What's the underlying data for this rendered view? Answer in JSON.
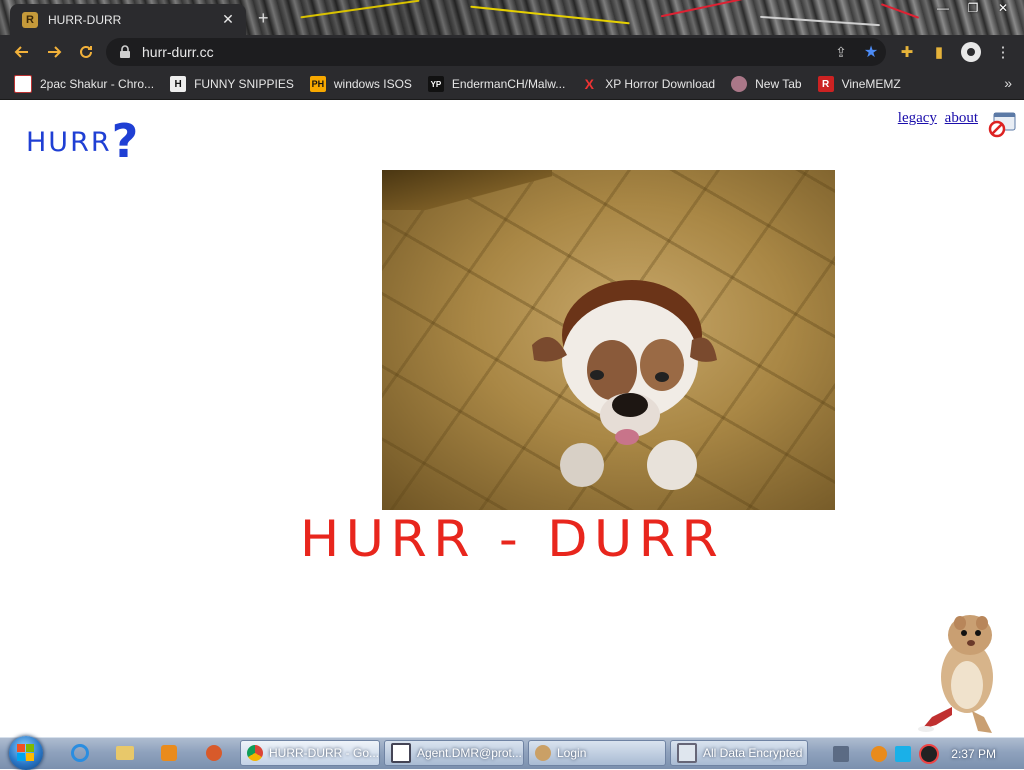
{
  "browser": {
    "tab_title": "HURR-DURR",
    "tab_close": "✕",
    "new_tab": "+",
    "url": "hurr-durr.cc",
    "back_icon": "arrow-left-icon",
    "forward_icon": "arrow-right-icon",
    "reload_icon": "reload-icon",
    "menu": "⋮",
    "bookmarks_more": "»"
  },
  "bookmarks": [
    {
      "label": "2pac Shakur - Chro...",
      "icon": "bookmark-icon",
      "color": "#b33"
    },
    {
      "label": "FUNNY SNIPPIES",
      "icon": "H",
      "color": "#eee"
    },
    {
      "label": "windows ISOS",
      "icon": "PH",
      "color": "#f7a800"
    },
    {
      "label": "EndermanCH/Malw...",
      "icon": "YP",
      "color": "#333"
    },
    {
      "label": "XP Horror Download",
      "icon": "X",
      "color": "#e33"
    },
    {
      "label": "New Tab",
      "icon": "globe-icon",
      "color": "#a78"
    },
    {
      "label": "VineMEMZ",
      "icon": "R",
      "color": "#c22"
    }
  ],
  "page": {
    "logo_text": "HURR",
    "logo_q": "?",
    "link_legacy": "legacy",
    "link_about": "about",
    "headline": "HURR - DURR"
  },
  "taskbar": {
    "buttons": [
      {
        "label": "HURR-DURR - Go..."
      },
      {
        "label": "Agent.DMR@prot..."
      },
      {
        "label": "Login"
      },
      {
        "label": "All Data Encrypted"
      }
    ],
    "clock": "2:37 PM"
  },
  "colors": {
    "logo": "#1f3fd4",
    "headline": "#e8261d",
    "link": "#1a0dab",
    "chrome_dark": "#2b2b2e",
    "accent_yellow": "#e6b33a",
    "star_blue": "#4c8bf5"
  }
}
